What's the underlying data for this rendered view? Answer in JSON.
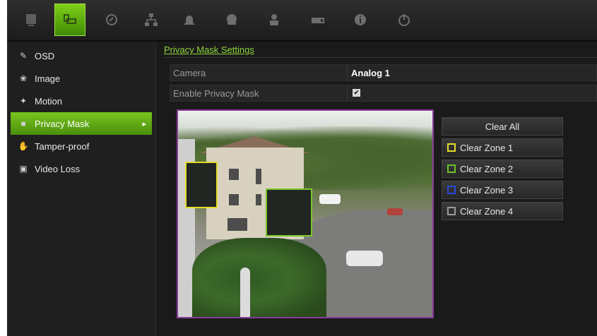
{
  "toolbar": {
    "icons": [
      "monitor-icon",
      "camera-icon",
      "recording-icon",
      "network-icon",
      "alarm-icon",
      "device-icon",
      "user-icon",
      "storage-icon",
      "info-icon",
      "power-icon"
    ],
    "active_index": 1,
    "accent": "#6cbc18"
  },
  "sidebar": {
    "items": [
      {
        "label": "OSD",
        "icon": "osd-icon"
      },
      {
        "label": "Image",
        "icon": "image-icon"
      },
      {
        "label": "Motion",
        "icon": "motion-icon"
      },
      {
        "label": "Privacy Mask",
        "icon": "privacy-mask-icon",
        "active": true
      },
      {
        "label": "Tamper-proof",
        "icon": "tamper-icon"
      },
      {
        "label": "Video Loss",
        "icon": "video-loss-icon"
      }
    ]
  },
  "main": {
    "title": "Privacy Mask Settings",
    "camera_label": "Camera",
    "camera_value": "Analog 1",
    "enable_label": "Enable Privacy Mask",
    "enable_checked": true,
    "clear_all_label": "Clear All",
    "zones": [
      {
        "label": "Clear Zone 1",
        "color": "#e4dc2a"
      },
      {
        "label": "Clear Zone 2",
        "color": "#6cc22a"
      },
      {
        "label": "Clear Zone 3",
        "color": "#2a4ad8"
      },
      {
        "label": "Clear Zone 4",
        "color": "#9a9a9a"
      }
    ]
  }
}
